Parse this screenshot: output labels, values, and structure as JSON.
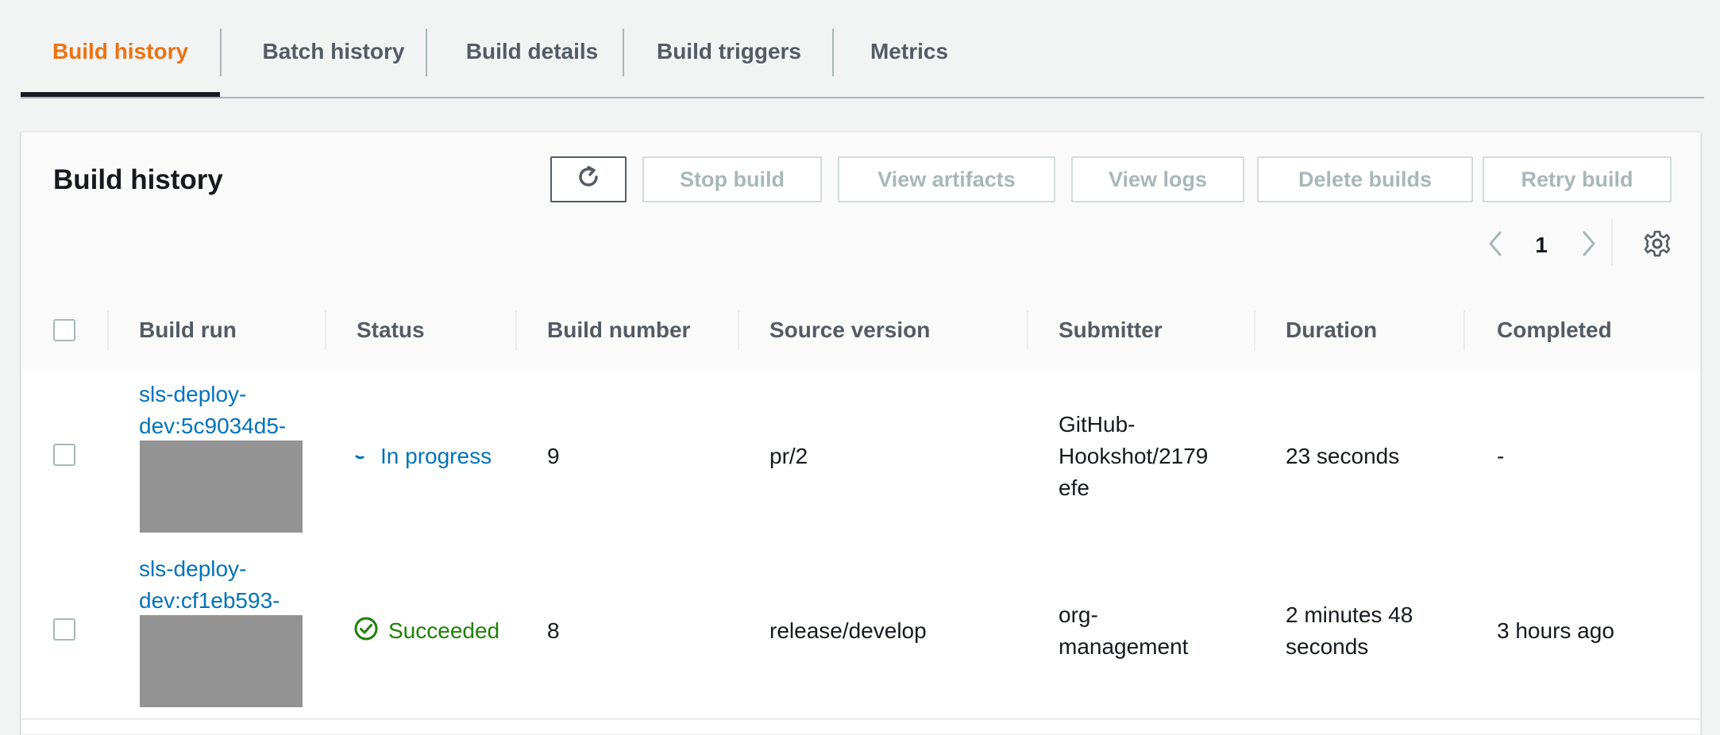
{
  "tabs": [
    {
      "label": "Build history",
      "active": true
    },
    {
      "label": "Batch history",
      "active": false
    },
    {
      "label": "Build details",
      "active": false
    },
    {
      "label": "Build triggers",
      "active": false
    },
    {
      "label": "Metrics",
      "active": false
    }
  ],
  "panel": {
    "title": "Build history",
    "buttons": {
      "refresh_icon": "refresh-icon",
      "stop": "Stop build",
      "artifacts": "View artifacts",
      "logs": "View logs",
      "delete": "Delete builds",
      "retry": "Retry build"
    },
    "pagination": {
      "current_page": "1"
    },
    "settings_icon": "gear-icon"
  },
  "table": {
    "columns": [
      "Build run",
      "Status",
      "Build number",
      "Source version",
      "Submitter",
      "Duration",
      "Completed"
    ],
    "rows": [
      {
        "build_run": "sls-deploy-dev:5c9034d5-",
        "build_run_line1": "sls-deploy-",
        "build_run_line2": "dev:5c9034d5-",
        "status": "In progress",
        "status_icon": "spinner-icon",
        "build_number": "9",
        "source_version": "pr/2",
        "submitter": "GitHub-Hookshot/2179efe",
        "submitter_lines": [
          "GitHub-",
          "Hookshot/2179",
          "efe"
        ],
        "duration": "23 seconds",
        "duration_lines": [
          "23 seconds"
        ],
        "completed": "-"
      },
      {
        "build_run": "sls-deploy-dev:cf1eb593-",
        "build_run_line1": "sls-deploy-",
        "build_run_line2": "dev:cf1eb593-",
        "status": "Succeeded",
        "status_icon": "check-circle-icon",
        "build_number": "8",
        "source_version": "release/develop",
        "submitter": "org-management",
        "submitter_lines": [
          "org-",
          "management"
        ],
        "duration": "2 minutes 48 seconds",
        "duration_lines": [
          "2 minutes 48",
          "seconds"
        ],
        "completed": "3 hours ago"
      }
    ]
  },
  "colors": {
    "accent_orange": "#ec7211",
    "link_blue": "#0073bb",
    "success_green": "#1d8102",
    "disabled_text": "#aab7b8"
  }
}
